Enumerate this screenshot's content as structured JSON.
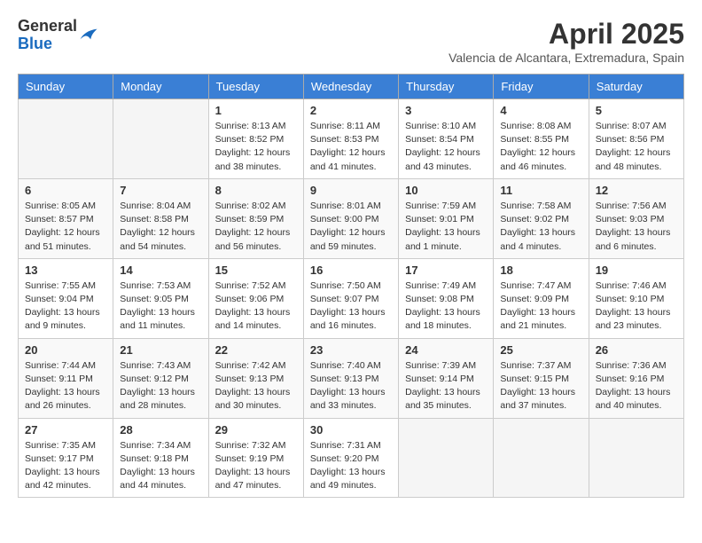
{
  "header": {
    "logo_general": "General",
    "logo_blue": "Blue",
    "month_title": "April 2025",
    "subtitle": "Valencia de Alcantara, Extremadura, Spain"
  },
  "weekdays": [
    "Sunday",
    "Monday",
    "Tuesday",
    "Wednesday",
    "Thursday",
    "Friday",
    "Saturday"
  ],
  "weeks": [
    [
      {
        "day": "",
        "info": ""
      },
      {
        "day": "",
        "info": ""
      },
      {
        "day": "1",
        "info": "Sunrise: 8:13 AM\nSunset: 8:52 PM\nDaylight: 12 hours and 38 minutes."
      },
      {
        "day": "2",
        "info": "Sunrise: 8:11 AM\nSunset: 8:53 PM\nDaylight: 12 hours and 41 minutes."
      },
      {
        "day": "3",
        "info": "Sunrise: 8:10 AM\nSunset: 8:54 PM\nDaylight: 12 hours and 43 minutes."
      },
      {
        "day": "4",
        "info": "Sunrise: 8:08 AM\nSunset: 8:55 PM\nDaylight: 12 hours and 46 minutes."
      },
      {
        "day": "5",
        "info": "Sunrise: 8:07 AM\nSunset: 8:56 PM\nDaylight: 12 hours and 48 minutes."
      }
    ],
    [
      {
        "day": "6",
        "info": "Sunrise: 8:05 AM\nSunset: 8:57 PM\nDaylight: 12 hours and 51 minutes."
      },
      {
        "day": "7",
        "info": "Sunrise: 8:04 AM\nSunset: 8:58 PM\nDaylight: 12 hours and 54 minutes."
      },
      {
        "day": "8",
        "info": "Sunrise: 8:02 AM\nSunset: 8:59 PM\nDaylight: 12 hours and 56 minutes."
      },
      {
        "day": "9",
        "info": "Sunrise: 8:01 AM\nSunset: 9:00 PM\nDaylight: 12 hours and 59 minutes."
      },
      {
        "day": "10",
        "info": "Sunrise: 7:59 AM\nSunset: 9:01 PM\nDaylight: 13 hours and 1 minute."
      },
      {
        "day": "11",
        "info": "Sunrise: 7:58 AM\nSunset: 9:02 PM\nDaylight: 13 hours and 4 minutes."
      },
      {
        "day": "12",
        "info": "Sunrise: 7:56 AM\nSunset: 9:03 PM\nDaylight: 13 hours and 6 minutes."
      }
    ],
    [
      {
        "day": "13",
        "info": "Sunrise: 7:55 AM\nSunset: 9:04 PM\nDaylight: 13 hours and 9 minutes."
      },
      {
        "day": "14",
        "info": "Sunrise: 7:53 AM\nSunset: 9:05 PM\nDaylight: 13 hours and 11 minutes."
      },
      {
        "day": "15",
        "info": "Sunrise: 7:52 AM\nSunset: 9:06 PM\nDaylight: 13 hours and 14 minutes."
      },
      {
        "day": "16",
        "info": "Sunrise: 7:50 AM\nSunset: 9:07 PM\nDaylight: 13 hours and 16 minutes."
      },
      {
        "day": "17",
        "info": "Sunrise: 7:49 AM\nSunset: 9:08 PM\nDaylight: 13 hours and 18 minutes."
      },
      {
        "day": "18",
        "info": "Sunrise: 7:47 AM\nSunset: 9:09 PM\nDaylight: 13 hours and 21 minutes."
      },
      {
        "day": "19",
        "info": "Sunrise: 7:46 AM\nSunset: 9:10 PM\nDaylight: 13 hours and 23 minutes."
      }
    ],
    [
      {
        "day": "20",
        "info": "Sunrise: 7:44 AM\nSunset: 9:11 PM\nDaylight: 13 hours and 26 minutes."
      },
      {
        "day": "21",
        "info": "Sunrise: 7:43 AM\nSunset: 9:12 PM\nDaylight: 13 hours and 28 minutes."
      },
      {
        "day": "22",
        "info": "Sunrise: 7:42 AM\nSunset: 9:13 PM\nDaylight: 13 hours and 30 minutes."
      },
      {
        "day": "23",
        "info": "Sunrise: 7:40 AM\nSunset: 9:13 PM\nDaylight: 13 hours and 33 minutes."
      },
      {
        "day": "24",
        "info": "Sunrise: 7:39 AM\nSunset: 9:14 PM\nDaylight: 13 hours and 35 minutes."
      },
      {
        "day": "25",
        "info": "Sunrise: 7:37 AM\nSunset: 9:15 PM\nDaylight: 13 hours and 37 minutes."
      },
      {
        "day": "26",
        "info": "Sunrise: 7:36 AM\nSunset: 9:16 PM\nDaylight: 13 hours and 40 minutes."
      }
    ],
    [
      {
        "day": "27",
        "info": "Sunrise: 7:35 AM\nSunset: 9:17 PM\nDaylight: 13 hours and 42 minutes."
      },
      {
        "day": "28",
        "info": "Sunrise: 7:34 AM\nSunset: 9:18 PM\nDaylight: 13 hours and 44 minutes."
      },
      {
        "day": "29",
        "info": "Sunrise: 7:32 AM\nSunset: 9:19 PM\nDaylight: 13 hours and 47 minutes."
      },
      {
        "day": "30",
        "info": "Sunrise: 7:31 AM\nSunset: 9:20 PM\nDaylight: 13 hours and 49 minutes."
      },
      {
        "day": "",
        "info": ""
      },
      {
        "day": "",
        "info": ""
      },
      {
        "day": "",
        "info": ""
      }
    ]
  ]
}
